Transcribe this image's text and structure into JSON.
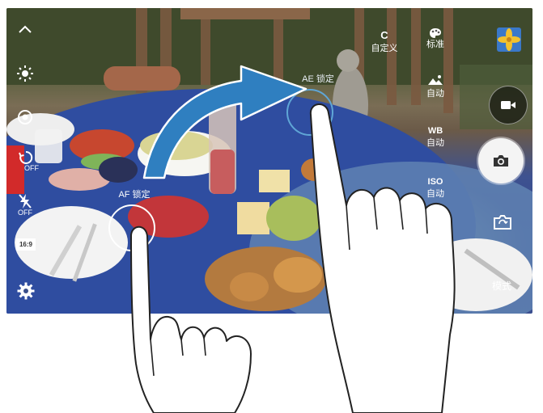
{
  "camera": {
    "left_toolbar": {
      "collapse": "^",
      "timer_state": "OFF",
      "flash_state": "OFF",
      "ratio": "16:9"
    },
    "modes": {
      "custom_letter": "C",
      "custom_label": "自定义",
      "filter_label": "标准",
      "exposure_label": "自动",
      "wb_title": "WB",
      "wb_value": "自动",
      "iso_title": "ISO",
      "iso_value": "自动",
      "mode_label": "模式"
    },
    "locks": {
      "ae_label": "AE 锁定",
      "af_label": "AF 锁定"
    }
  },
  "colors": {
    "accent": "#4aa3d8",
    "lock_ring_ae": "#5fa6d6",
    "lock_ring_af": "#ffffff",
    "arrow": "#2f7fc0"
  },
  "icons": {
    "collapse": "chevron-up-icon",
    "brightness": "sun-icon",
    "focus": "focus-icon",
    "timer": "timer-icon",
    "flash": "flash-off-icon",
    "ratio": "aspect-ratio-icon",
    "settings": "gear-icon",
    "filter": "palette-icon",
    "exposure": "exposure-icon",
    "video": "video-camera-icon",
    "shutter": "camera-icon",
    "switch": "switch-camera-icon",
    "gallery": "gallery-thumbnail-icon"
  }
}
